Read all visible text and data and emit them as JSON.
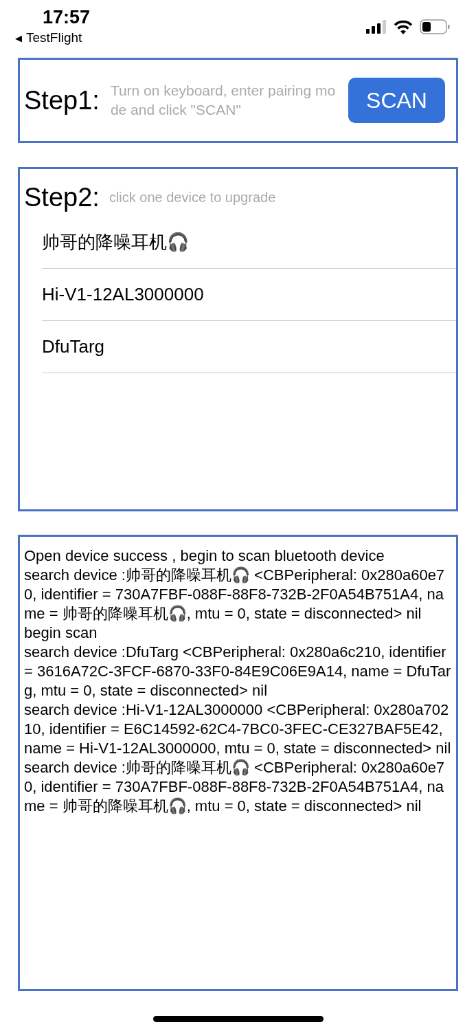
{
  "status_bar": {
    "time": "17:57",
    "back_arrow": "◀",
    "back_label": "TestFlight"
  },
  "step1": {
    "label": "Step1:",
    "hint": "Turn on keyboard, enter pairing mode and click \"SCAN\"",
    "button": "SCAN"
  },
  "step2": {
    "label": "Step2:",
    "hint": "click one device to upgrade",
    "devices": [
      {
        "name": "帅哥的降噪耳机🎧"
      },
      {
        "name": "Hi-V1-12AL3000000"
      },
      {
        "name": "DfuTarg"
      }
    ]
  },
  "log": [
    "Open device success , begin to scan bluetooth device",
    "search device :帅哥的降噪耳机🎧 <CBPeripheral: 0x280a60e70, identifier = 730A7FBF-088F-88F8-732B-2F0A54B751A4, name = 帅哥的降噪耳机🎧, mtu = 0, state = disconnected> nil",
    "begin scan",
    "search device :DfuTarg <CBPeripheral: 0x280a6c210, identifier = 3616A72C-3FCF-6870-33F0-84E9C06E9A14, name = DfuTarg, mtu = 0, state = disconnected> nil",
    "search device :Hi-V1-12AL3000000 <CBPeripheral: 0x280a70210, identifier = E6C14592-62C4-7BC0-3FEC-CE327BAF5E42, name = Hi-V1-12AL3000000, mtu = 0, state = disconnected> nil",
    "search device :帅哥的降噪耳机🎧 <CBPeripheral: 0x280a60e70, identifier = 730A7FBF-088F-88F8-732B-2F0A54B751A4, name = 帅哥的降噪耳机🎧, mtu = 0, state = disconnected> nil"
  ]
}
